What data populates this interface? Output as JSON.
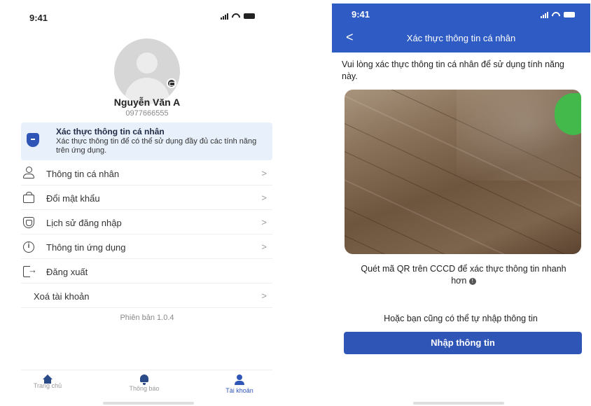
{
  "left": {
    "status_time": "9:41",
    "profile": {
      "name": "Nguyễn Văn A",
      "phone": "0977666555"
    },
    "verify_card": {
      "title": "Xác thực thông tin cá nhân",
      "description": "Xác thực thông tin để có thể sử dụng đầy đủ các tính năng trên ứng dụng."
    },
    "menu": [
      {
        "label": "Thông tin cá nhân",
        "chevron": ">",
        "icon": "user-icon"
      },
      {
        "label": "Đổi mật khẩu",
        "chevron": ">",
        "icon": "bag-icon"
      },
      {
        "label": "Lịch sử đăng nhập",
        "chevron": ">",
        "icon": "shield-icon"
      },
      {
        "label": "Thông tin ứng dụng",
        "chevron": ">",
        "icon": "info-icon"
      },
      {
        "label": "Đăng xuất",
        "chevron": "",
        "icon": "logout-icon"
      },
      {
        "label": "Xoá tài khoản",
        "chevron": ">",
        "icon": ""
      }
    ],
    "version": "Phiên bản 1.0.4",
    "tabs": [
      {
        "label": "Trang chủ",
        "icon": "home-icon"
      },
      {
        "label": "Thông báo",
        "icon": "bell-icon"
      },
      {
        "label": "Tài khoản",
        "icon": "account-icon",
        "active": true
      }
    ]
  },
  "right": {
    "status_time": "9:41",
    "header_title": "Xác thực thông tin cá nhân",
    "back_glyph": "<",
    "instruction": "Vui lòng xác thực thông tin cá nhân để sử dụng tính năng này.",
    "qr_hint": "Quét mã QR trên CCCD để xác thực thông tin nhanh hơn",
    "or_text": "Hoặc bạn cũng có thể tự nhập thông tin",
    "enter_button": "Nhập thông tin"
  },
  "colors": {
    "brand_blue": "#2f55b7",
    "header_blue": "#2f5bc4",
    "verify_bg": "#e8f0fb"
  }
}
